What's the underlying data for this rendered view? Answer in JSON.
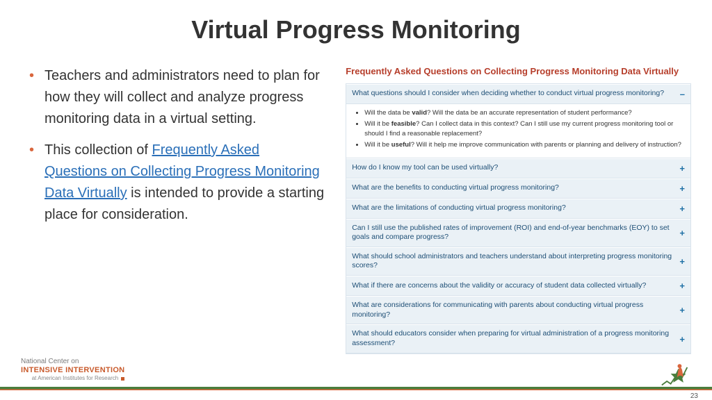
{
  "title": "Virtual Progress Monitoring",
  "bullets": {
    "b1": "Teachers and administrators need to plan for how they will collect and analyze progress monitoring data in a virtual setting.",
    "b2_pre": "This collection of ",
    "b2_link": "Frequently Asked Questions on Collecting Progress Monitoring Data Virtually",
    "b2_post": " is intended to provide a starting place for consideration."
  },
  "faq": {
    "heading": "Frequently Asked Questions on Collecting Progress Monitoring Data Virtually",
    "expanded": {
      "q": "What questions should I consider when deciding whether to conduct virtual progress monitoring?",
      "toggle": "–",
      "answers": {
        "a1_pre": "Will the data be ",
        "a1_b": "valid",
        "a1_post": "? Will the data be an accurate representation of student performance?",
        "a2_pre": "Will it be ",
        "a2_b": "feasible",
        "a2_post": "? Can I collect data in this context? Can I still use my current progress monitoring tool or should I find a reasonable replacement?",
        "a3_pre": "Will it be ",
        "a3_b": "useful",
        "a3_post": "? Will it help me improve communication with parents or planning and delivery of instruction?"
      }
    },
    "items": [
      "How do I know my tool can be used virtually?",
      "What are the benefits to conducting virtual progress monitoring?",
      "What are the limitations of conducting virtual progress monitoring?",
      "Can I still use the published rates of improvement (ROI) and end-of-year benchmarks (EOY) to set goals and compare progress?",
      "What should school administrators and teachers understand about interpreting progress monitoring scores?",
      "What if there are concerns about the validity or accuracy of student data collected virtually?",
      "What are considerations for communicating with parents about conducting virtual progress monitoring?",
      "What should educators consider when preparing for virtual administration of a progress monitoring assessment?"
    ],
    "plus": "+"
  },
  "footer": {
    "l1": "National Center on",
    "l2": "INTENSIVE INTERVENTION",
    "l3": "at American Institutes for Research"
  },
  "page": "23"
}
